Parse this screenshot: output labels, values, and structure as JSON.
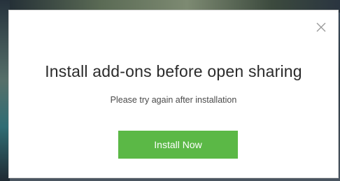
{
  "dialog": {
    "title": "Install add-ons before open sharing",
    "message": "Please try again after installation",
    "install_button_label": "Install Now",
    "close_icon": "close-icon",
    "accent_color": "#5bb846"
  }
}
